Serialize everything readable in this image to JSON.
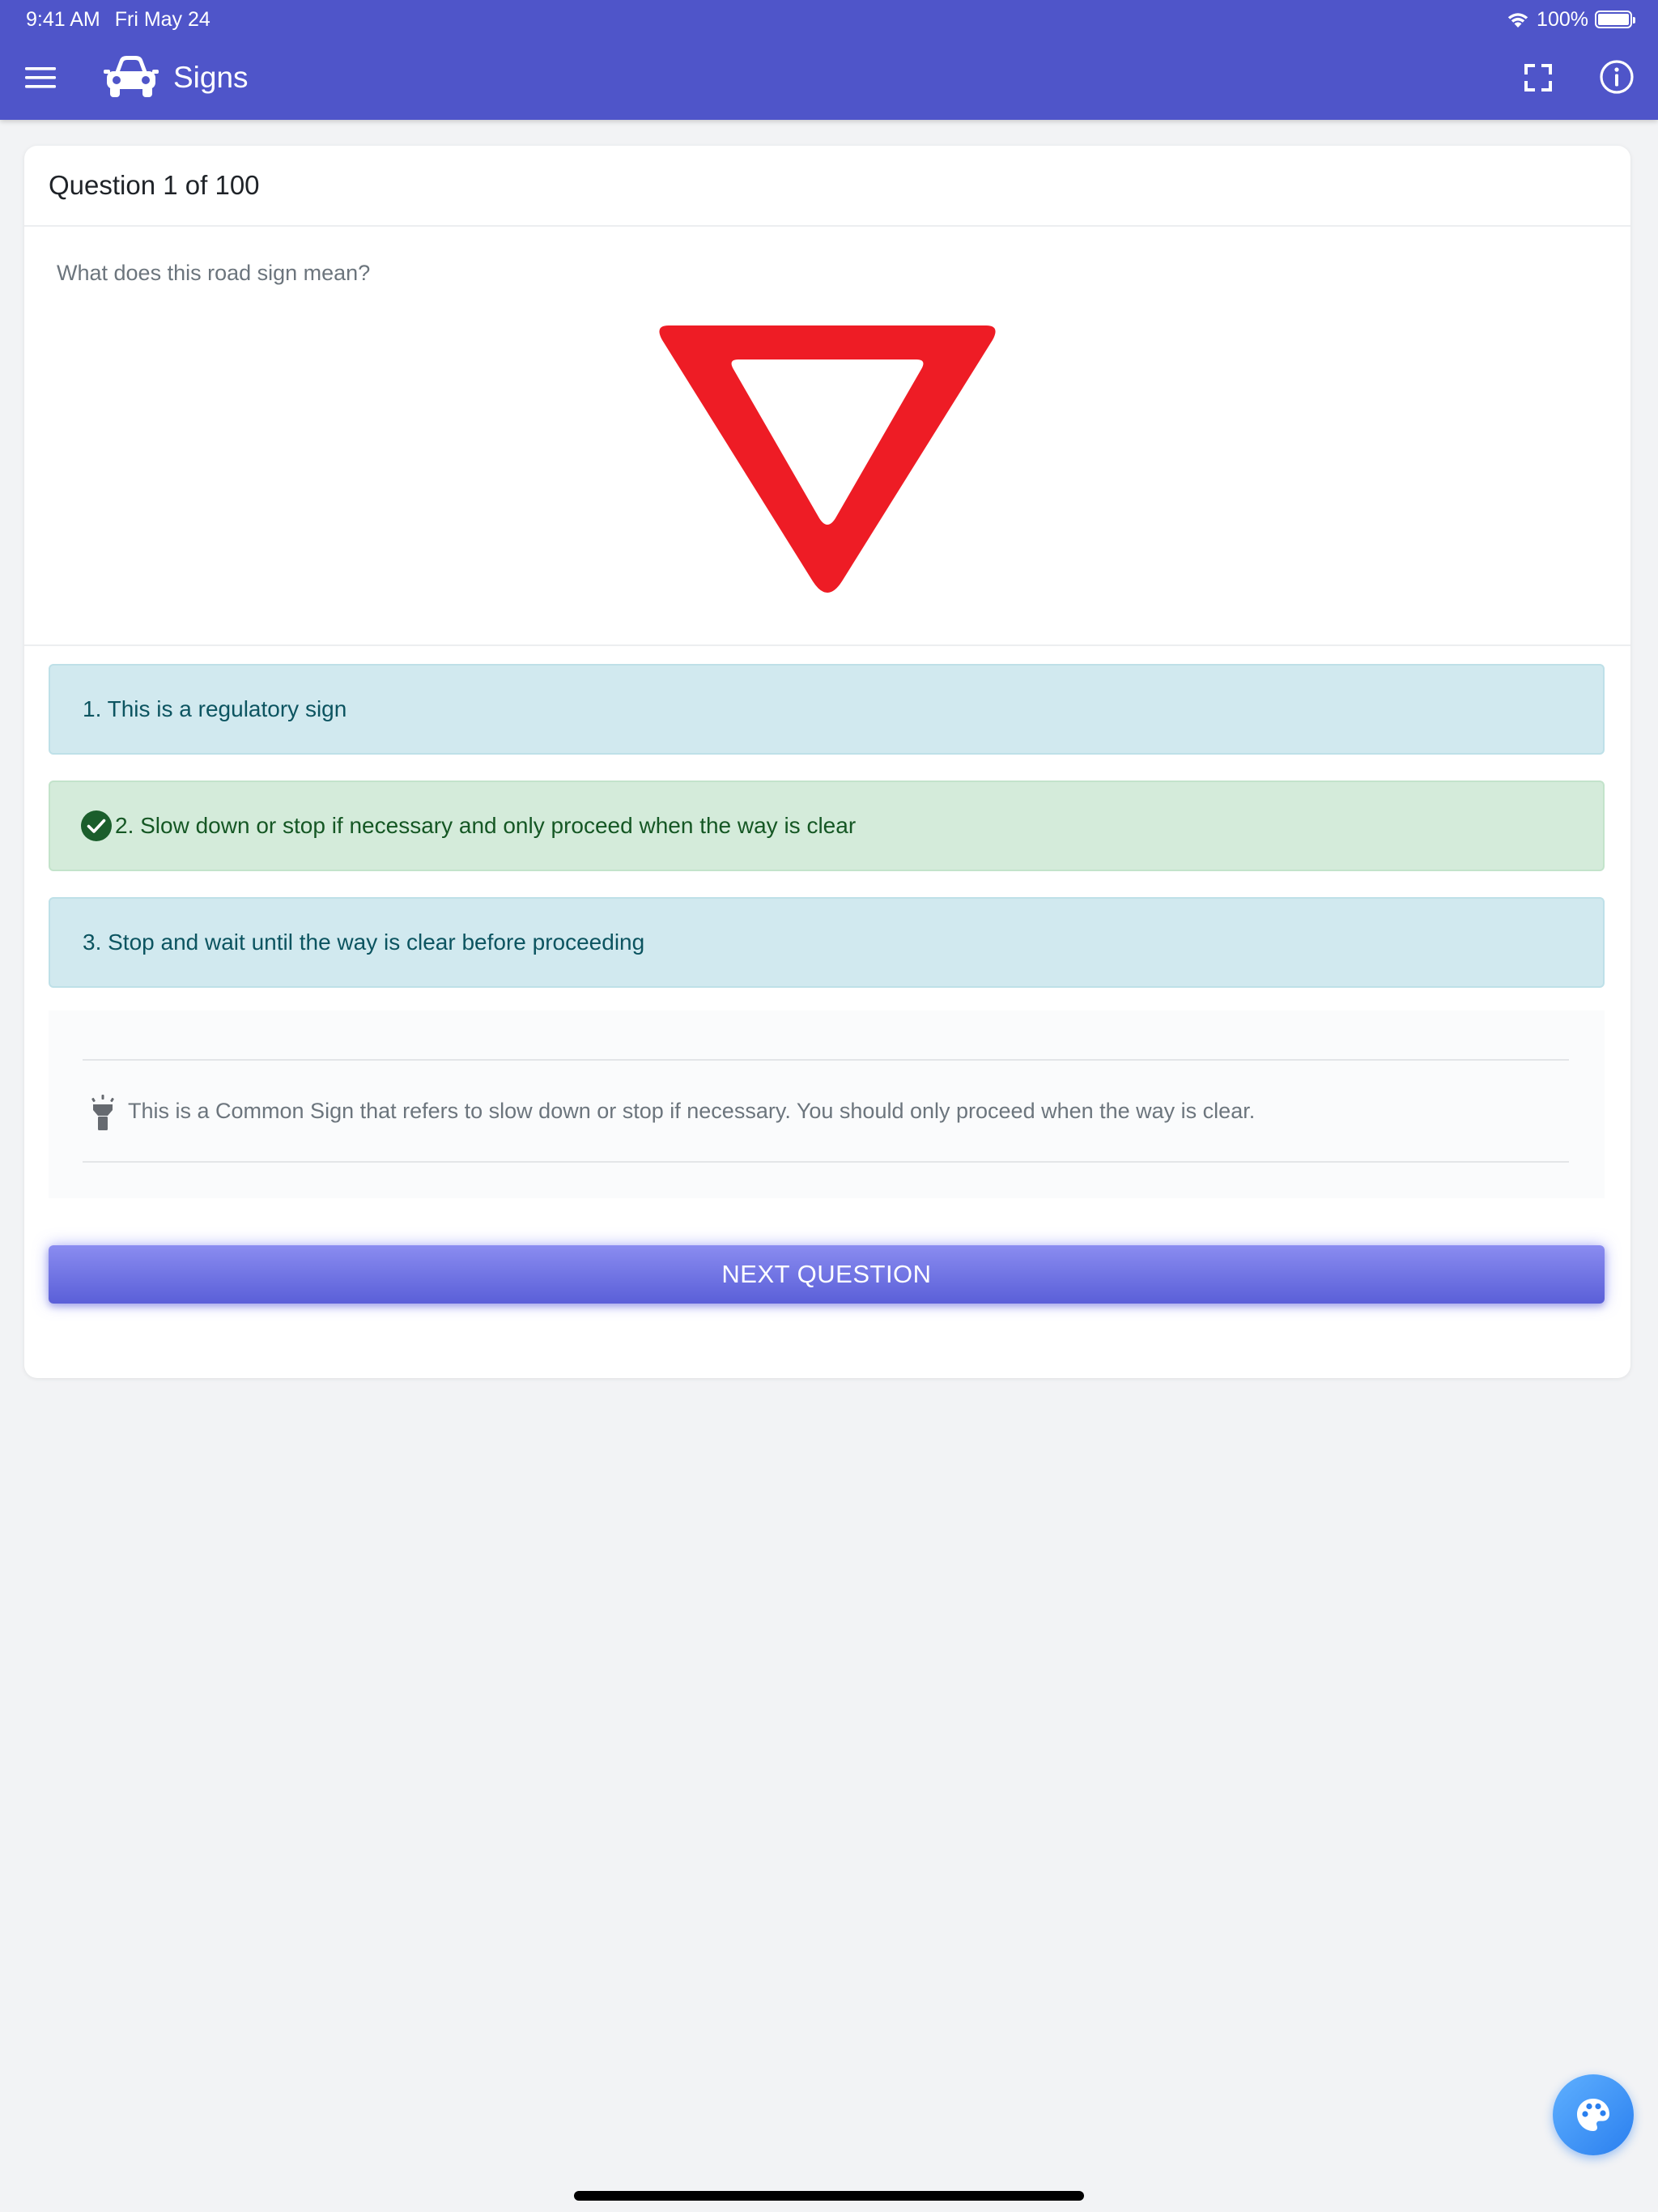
{
  "status_bar": {
    "time": "9:41 AM",
    "date": "Fri May 24",
    "battery": "100%",
    "battery_level": 1.0
  },
  "app_bar": {
    "title": "Signs",
    "icons": {
      "menu": "menu-icon",
      "logo": "car-icon",
      "fullscreen": "fullscreen-icon",
      "info": "info-icon"
    },
    "color": "#4f55c9"
  },
  "quiz": {
    "header": "Question 1 of 100",
    "question": "What does this road sign mean?",
    "sign": "yield-sign",
    "answers": [
      {
        "label": "1. This is a regulatory sign",
        "state": "info"
      },
      {
        "label": "2. Slow down or stop if necessary and only proceed when the way is clear",
        "state": "correct"
      },
      {
        "label": "3. Stop and wait until the way is clear before proceeding",
        "state": "info"
      }
    ],
    "explanation": "This is a Common Sign that refers to slow down or stop if necessary. You should only proceed when the way is clear.",
    "next_label": "NEXT QUESTION"
  },
  "colors": {
    "accent": "#4f55c9",
    "sign_red": "#ee1c25",
    "answer_info_bg": "#d1e9ef",
    "answer_correct_bg": "#d4ebda",
    "fab": "#2a7fef"
  },
  "fab": {
    "icon": "palette-icon"
  }
}
